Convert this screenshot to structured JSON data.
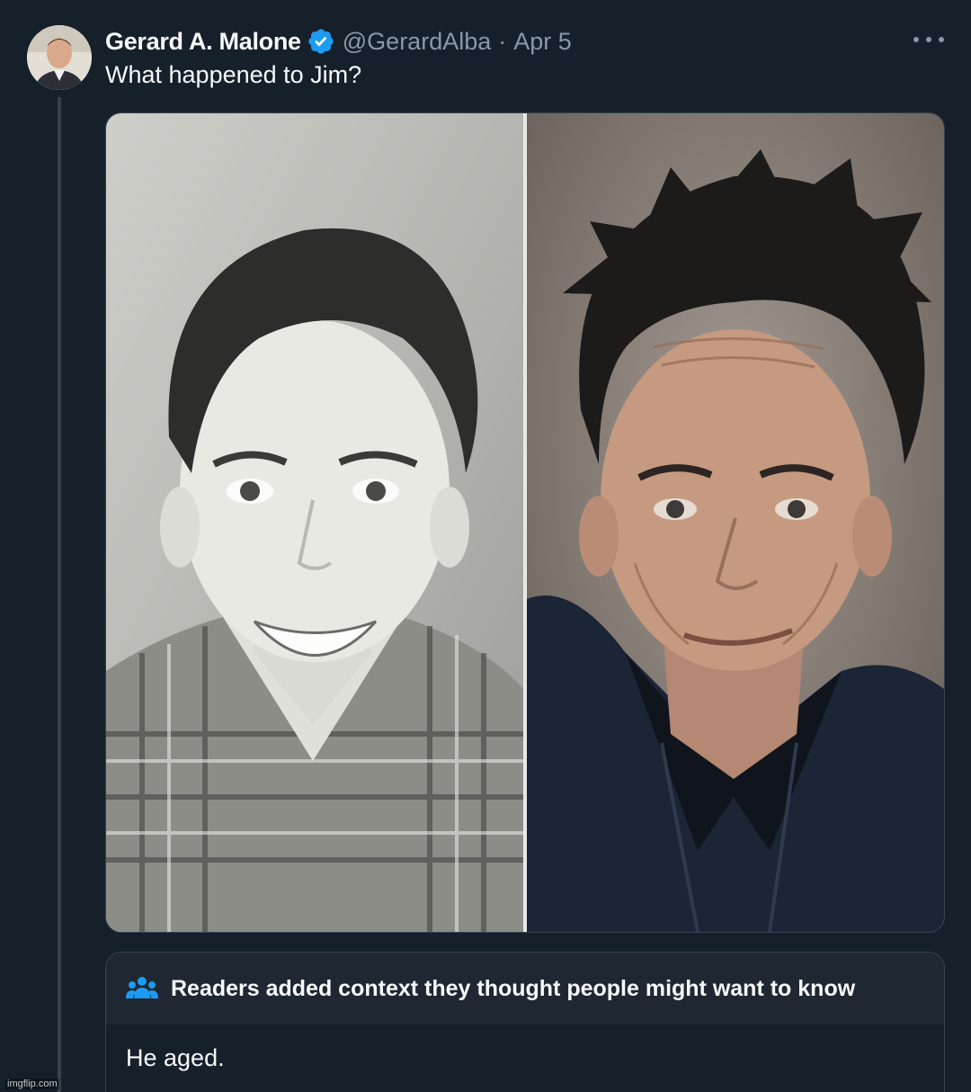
{
  "tweet": {
    "display_name": "Gerard A. Malone",
    "handle": "@GerardAlba",
    "separator": "·",
    "date": "Apr 5",
    "text": "What happened to Jim?"
  },
  "colors": {
    "background": "#15202b",
    "verified_badge": "#1d9bf0",
    "secondary_text": "#8b98a5",
    "context_icon": "#1d9bf0"
  },
  "icons": {
    "verified": "verified-badge-icon",
    "more": "more-options-icon",
    "context": "people-icon"
  },
  "community_note": {
    "title": "Readers added context they thought people might want to know",
    "body": "He aged."
  },
  "watermark": "imgflip.com"
}
